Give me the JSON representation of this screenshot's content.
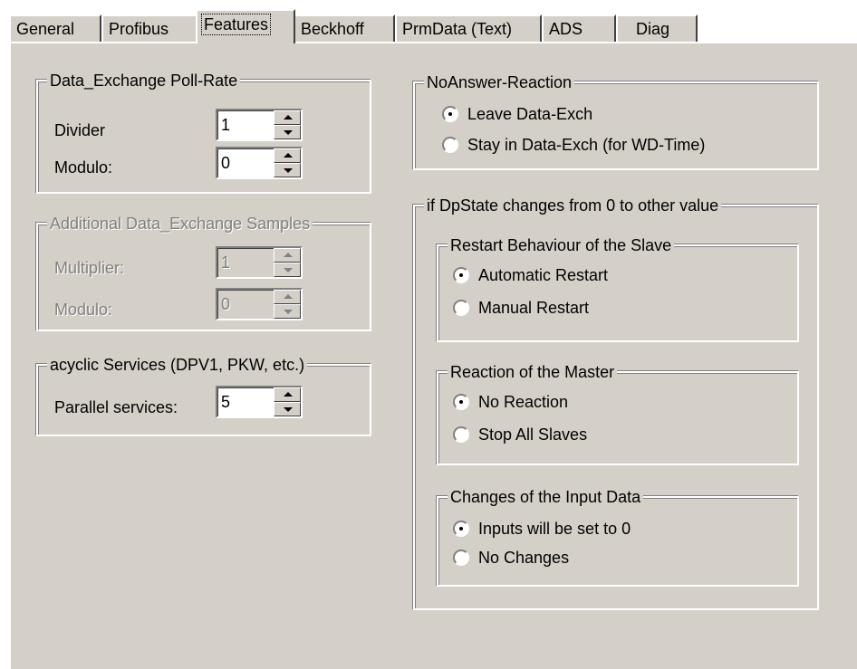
{
  "tabs": [
    {
      "label": "General",
      "active": false
    },
    {
      "label": "Profibus",
      "active": false
    },
    {
      "label": "Features",
      "active": true
    },
    {
      "label": "Beckhoff",
      "active": false
    },
    {
      "label": "PrmData (Text)",
      "active": false
    },
    {
      "label": "ADS",
      "active": false
    },
    {
      "label": "Diag",
      "active": false
    }
  ],
  "poll_rate": {
    "title": "Data_Exchange Poll-Rate",
    "divider_label": "Divider",
    "divider_value": "1",
    "modulo_label": "Modulo:",
    "modulo_value": "0"
  },
  "additional_samples": {
    "title": "Additional Data_Exchange Samples",
    "multiplier_label": "Multiplier:",
    "multiplier_value": "1",
    "modulo_label": "Modulo:",
    "modulo_value": "0",
    "enabled": false
  },
  "acyclic": {
    "title": "acyclic Services (DPV1, PKW, etc.)",
    "parallel_label": "Parallel services:",
    "parallel_value": "5"
  },
  "no_answer": {
    "title": "NoAnswer-Reaction",
    "options": [
      "Leave Data-Exch",
      "Stay in Data-Exch (for WD-Time)"
    ],
    "selected": 0
  },
  "dpstate": {
    "title": "if DpState changes from 0 to other value",
    "restart": {
      "title": "Restart Behaviour of the Slave",
      "options": [
        "Automatic Restart",
        "Manual Restart"
      ],
      "selected": 0
    },
    "master": {
      "title": "Reaction of the Master",
      "options": [
        "No Reaction",
        "Stop All Slaves"
      ],
      "selected": 0
    },
    "input_data": {
      "title": "Changes of the Input Data",
      "options": [
        "Inputs will be set to 0",
        "No Changes"
      ],
      "selected": 0
    }
  }
}
